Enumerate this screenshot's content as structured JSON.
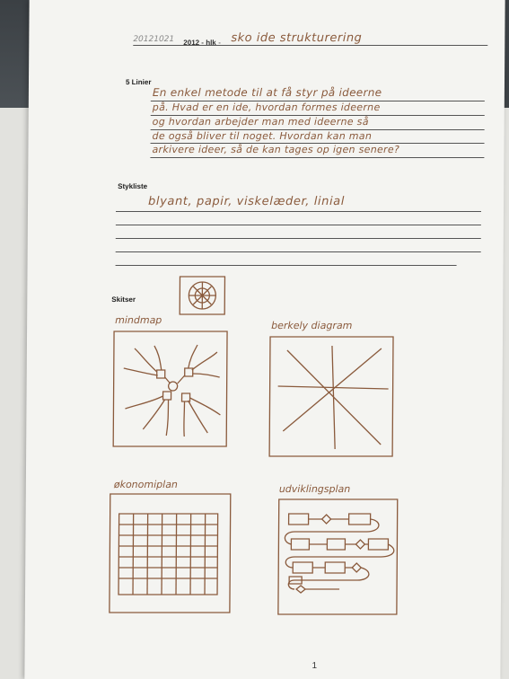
{
  "header": {
    "date": "20121021",
    "year": "2012 - hlk",
    "separator": "-",
    "title": "sko ide strukturering"
  },
  "section_lines": {
    "label": "5 Linier",
    "rows": [
      "En enkel metode til at få styr på ideerne",
      "på. Hvad er en ide, hvordan formes ideerne",
      "og hvordan arbejder man med ideerne så",
      "de også bliver til noget. Hvordan kan man",
      "arkivere ideer, så de kan tages op igen senere?"
    ]
  },
  "stykliste": {
    "label": "Stykliste",
    "items": "blyant, papir, viskelæder, linial"
  },
  "skitser": {
    "label": "Skitser",
    "sketches": [
      "mindmap",
      "berkely diagram",
      "økonomiplan",
      "udviklingsplan"
    ]
  },
  "footer": {
    "page_number": "1"
  },
  "colors": {
    "ink": "#8a5a3c",
    "paper": "#f4f4f1",
    "print": "#333333"
  }
}
